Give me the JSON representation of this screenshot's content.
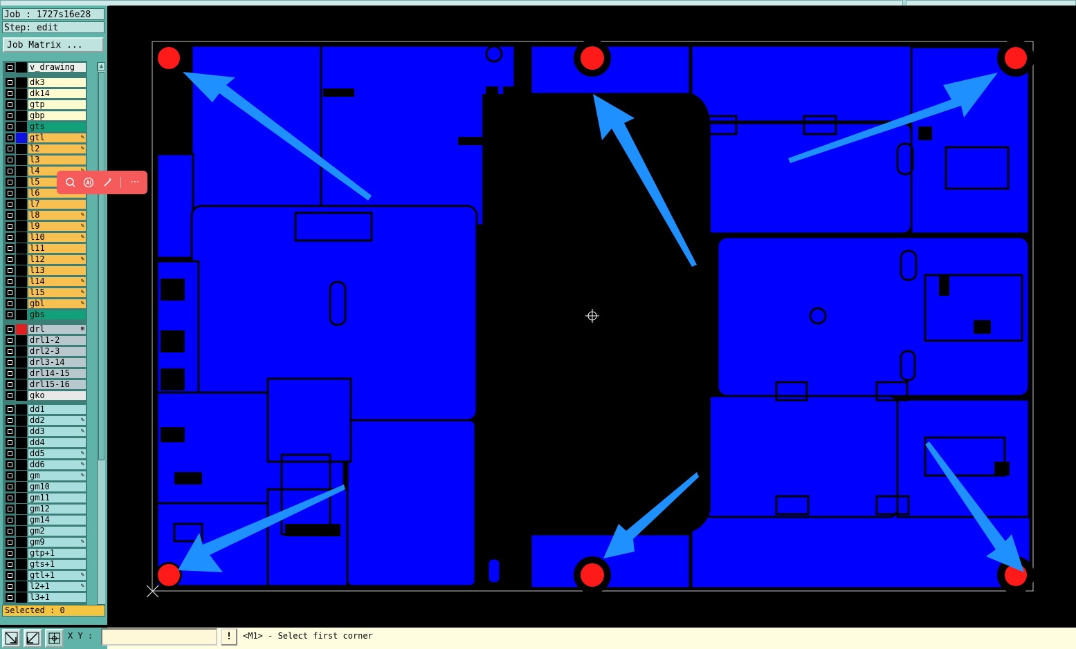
{
  "header": {
    "job": "Job : 1727s16e28",
    "step": "Step: edit"
  },
  "job_matrix_button": "Job Matrix ...",
  "layers": [
    {
      "name": "v_drawing",
      "color": "#e9efe9",
      "swatch": "#000000",
      "flag": ""
    },
    {
      "name": "dk3",
      "color": "#fffbd0",
      "swatch": "#000000",
      "flag": ""
    },
    {
      "name": "dk14",
      "color": "#fffbd0",
      "swatch": "#000000",
      "flag": ""
    },
    {
      "name": "gtp",
      "color": "#fffbd0",
      "swatch": "#000000",
      "flag": ""
    },
    {
      "name": "gbp",
      "color": "#fffbd0",
      "swatch": "#000000",
      "flag": ""
    },
    {
      "name": "gts",
      "color": "#12a07a",
      "swatch": "#000000",
      "flag": ""
    },
    {
      "name": "gtl",
      "color": "#f8c050",
      "swatch": "#1010e0",
      "flag": "✎"
    },
    {
      "name": "l2",
      "color": "#f8c050",
      "swatch": "#000000",
      "flag": "✎"
    },
    {
      "name": "l3",
      "color": "#f8c050",
      "swatch": "#000000",
      "flag": ""
    },
    {
      "name": "l4",
      "color": "#f8c050",
      "swatch": "#000000",
      "flag": "✎"
    },
    {
      "name": "l5",
      "color": "#f8c050",
      "swatch": "#000000",
      "flag": "✎"
    },
    {
      "name": "l6",
      "color": "#f8c050",
      "swatch": "#000000",
      "flag": "✎"
    },
    {
      "name": "l7",
      "color": "#f8c050",
      "swatch": "#000000",
      "flag": ""
    },
    {
      "name": "l8",
      "color": "#f8c050",
      "swatch": "#000000",
      "flag": "✎"
    },
    {
      "name": "l9",
      "color": "#f8c050",
      "swatch": "#000000",
      "flag": "✎"
    },
    {
      "name": "l10",
      "color": "#f8c050",
      "swatch": "#000000",
      "flag": "✎"
    },
    {
      "name": "l11",
      "color": "#f8c050",
      "swatch": "#000000",
      "flag": ""
    },
    {
      "name": "l12",
      "color": "#f8c050",
      "swatch": "#000000",
      "flag": "✎"
    },
    {
      "name": "l13",
      "color": "#f8c050",
      "swatch": "#000000",
      "flag": ""
    },
    {
      "name": "l14",
      "color": "#f8c050",
      "swatch": "#000000",
      "flag": "✎"
    },
    {
      "name": "l15",
      "color": "#f8c050",
      "swatch": "#000000",
      "flag": "✎"
    },
    {
      "name": "gbl",
      "color": "#f8c050",
      "swatch": "#000000",
      "flag": "✎"
    },
    {
      "name": "gbs",
      "color": "#12a07a",
      "swatch": "#000000",
      "flag": ""
    },
    {
      "name": "drl",
      "color": "#b8c8cc",
      "swatch": "#e02020",
      "flag": "⊞"
    },
    {
      "name": "drl1-2",
      "color": "#b8c8cc",
      "swatch": "#000000",
      "flag": ""
    },
    {
      "name": "drl2-3",
      "color": "#b8c8cc",
      "swatch": "#000000",
      "flag": ""
    },
    {
      "name": "drl3-14",
      "color": "#b8c8cc",
      "swatch": "#000000",
      "flag": ""
    },
    {
      "name": "drl14-15",
      "color": "#b8c8cc",
      "swatch": "#000000",
      "flag": ""
    },
    {
      "name": "drl15-16",
      "color": "#b8c8cc",
      "swatch": "#000000",
      "flag": ""
    },
    {
      "name": "gko",
      "color": "#e8e8e8",
      "swatch": "#000000",
      "flag": ""
    },
    {
      "name": "dd1",
      "color": "#a8dede",
      "swatch": "#000000",
      "flag": ""
    },
    {
      "name": "dd2",
      "color": "#a8dede",
      "swatch": "#000000",
      "flag": "✎"
    },
    {
      "name": "dd3",
      "color": "#a8dede",
      "swatch": "#000000",
      "flag": "✎"
    },
    {
      "name": "dd4",
      "color": "#a8dede",
      "swatch": "#000000",
      "flag": ""
    },
    {
      "name": "dd5",
      "color": "#a8dede",
      "swatch": "#000000",
      "flag": "✎"
    },
    {
      "name": "dd6",
      "color": "#a8dede",
      "swatch": "#000000",
      "flag": "✎"
    },
    {
      "name": "gm",
      "color": "#a8dede",
      "swatch": "#000000",
      "flag": "✎"
    },
    {
      "name": "gm10",
      "color": "#a8dede",
      "swatch": "#000000",
      "flag": ""
    },
    {
      "name": "gm11",
      "color": "#a8dede",
      "swatch": "#000000",
      "flag": ""
    },
    {
      "name": "gm12",
      "color": "#a8dede",
      "swatch": "#000000",
      "flag": ""
    },
    {
      "name": "gm14",
      "color": "#a8dede",
      "swatch": "#000000",
      "flag": ""
    },
    {
      "name": "gm2",
      "color": "#a8dede",
      "swatch": "#000000",
      "flag": ""
    },
    {
      "name": "gm9",
      "color": "#a8dede",
      "swatch": "#000000",
      "flag": "✎"
    },
    {
      "name": "gtp+1",
      "color": "#a8dede",
      "swatch": "#000000",
      "flag": ""
    },
    {
      "name": "gts+1",
      "color": "#a8dede",
      "swatch": "#000000",
      "flag": ""
    },
    {
      "name": "gtl+1",
      "color": "#a8dede",
      "swatch": "#000000",
      "flag": "✎"
    },
    {
      "name": "l2+1",
      "color": "#a8dede",
      "swatch": "#000000",
      "flag": "✎"
    },
    {
      "name": "l3+1",
      "color": "#a8dede",
      "swatch": "#000000",
      "flag": ""
    }
  ],
  "selected_label": "Selected : 0",
  "status": {
    "xy_label": "X Y :",
    "xy_value": "",
    "exclaim": "!",
    "message": "<M1> - Select first corner"
  },
  "floating_toolbar": {
    "icons": [
      "search-icon",
      "ai-icon",
      "magic-wand-icon",
      "more-icon"
    ]
  },
  "colors": {
    "board": "#0000ff",
    "pad": "#ff1a1a",
    "arrow": "#1e90ff",
    "panel": "#5fb3a8"
  }
}
